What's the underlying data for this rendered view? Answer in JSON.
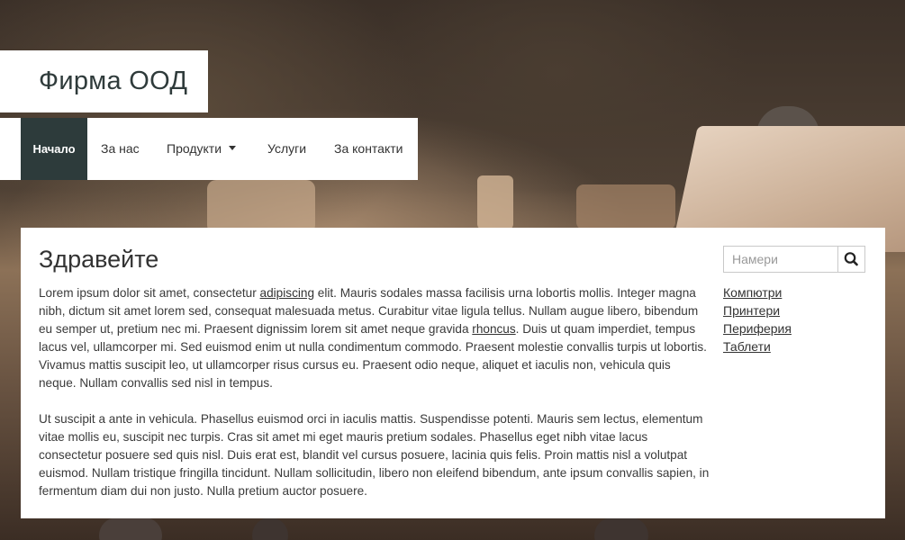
{
  "site": {
    "brand": "Фирма ООД"
  },
  "nav": {
    "items": [
      {
        "label": "Начало",
        "active": true
      },
      {
        "label": "За нас",
        "active": false
      },
      {
        "label": "Продукти",
        "active": false,
        "dropdown": true
      },
      {
        "label": "Услуги",
        "active": false
      },
      {
        "label": "За контакти",
        "active": false
      }
    ]
  },
  "main": {
    "title": "Здравейте",
    "p1": {
      "before_link1": "Lorem ipsum dolor sit amet, consectetur ",
      "link1": "adipiscing",
      "between": " elit. Mauris sodales massa facilisis urna lobortis mollis. Integer magna nibh, dictum sit amet lorem sed, consequat malesuada metus. Curabitur vitae ligula tellus. Nullam augue libero, bibendum eu semper ut, pretium nec mi. Praesent dignissim lorem sit amet neque gravida ",
      "link2": "rhoncus",
      "after_link2": ". Duis ut quam imperdiet, tempus lacus vel, ullamcorper mi. Sed euismod enim ut nulla condimentum commodo. Praesent molestie convallis turpis ut lobortis. Vivamus mattis suscipit leo, ut ullamcorper risus cursus eu. Praesent odio neque, aliquet et iaculis non, vehicula quis neque. Nullam convallis sed nisl in tempus."
    },
    "p2": "Ut suscipit a ante in vehicula. Phasellus euismod orci in iaculis mattis. Suspendisse potenti. Mauris sem lectus, elementum vitae mollis eu, suscipit nec turpis. Cras sit amet mi eget mauris pretium sodales. Phasellus eget nibh vitae lacus consectetur posuere sed quis nisl. Duis erat est, blandit vel cursus posuere, lacinia quis felis. Proin mattis nisl a volutpat euismod. Nullam tristique fringilla tincidunt. Nullam sollicitudin, libero non eleifend bibendum, ante ipsum convallis sapien, in fermentum diam dui non justo. Nulla pretium auctor posuere."
  },
  "sidebar": {
    "search": {
      "placeholder": "Намери",
      "value": "",
      "icon": "search-icon"
    },
    "links": [
      "Компютри",
      "Принтери",
      "Периферия",
      "Таблети"
    ]
  },
  "colors": {
    "nav_active_bg": "#2d3b3b",
    "panel_bg": "#ffffff"
  }
}
